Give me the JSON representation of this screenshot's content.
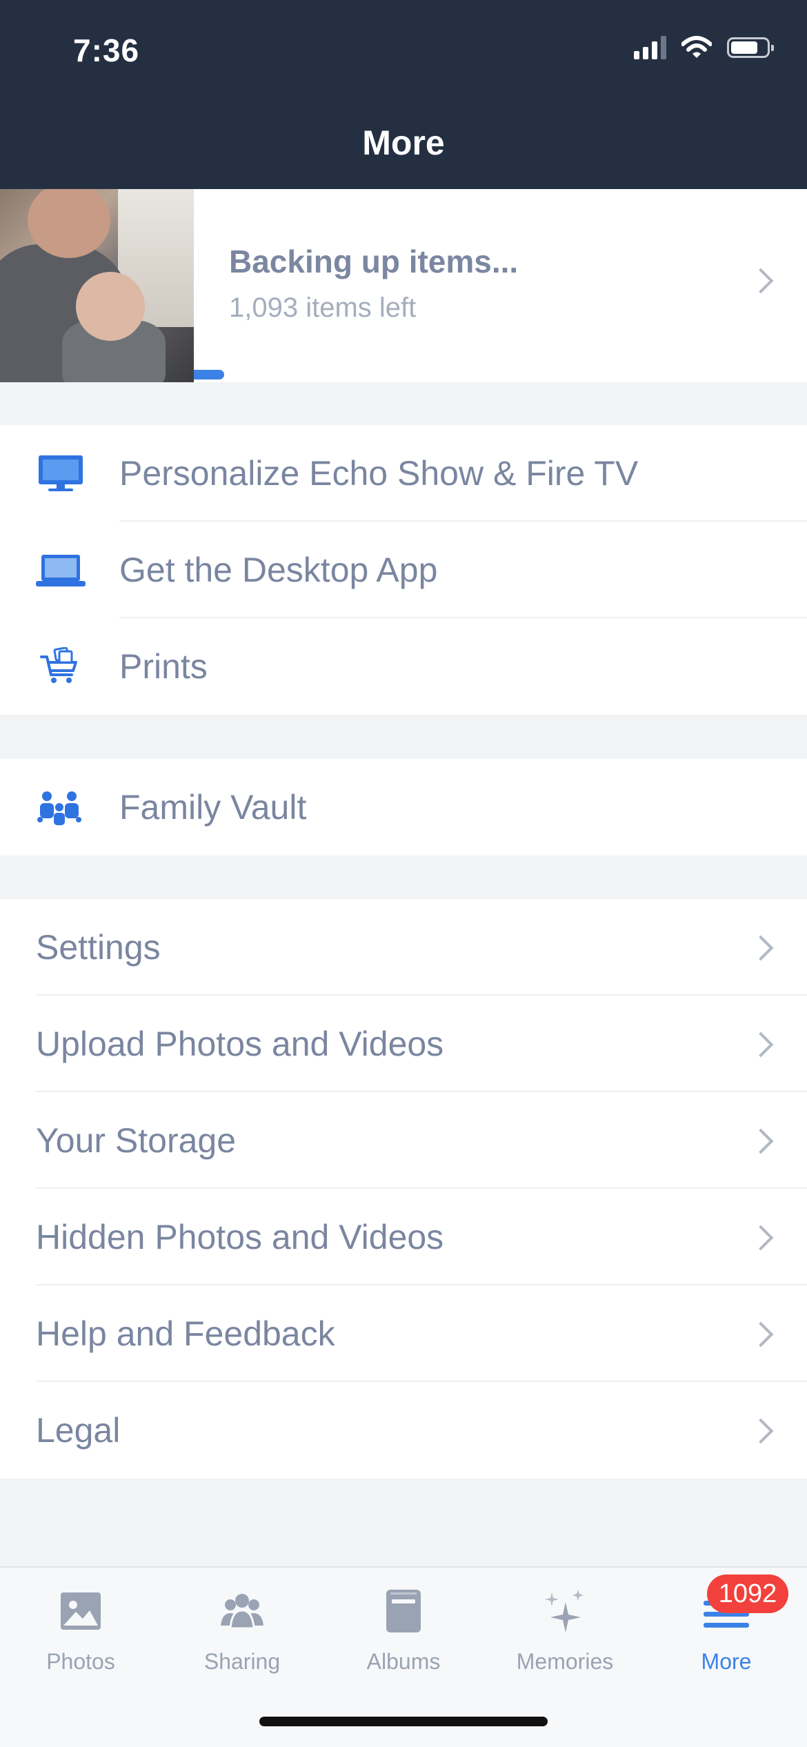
{
  "status_bar": {
    "time": "7:36"
  },
  "header": {
    "title": "More"
  },
  "backup": {
    "title": "Backing up items...",
    "subtitle": "1,093 items left",
    "progress_fraction": 0.05
  },
  "section_devices": {
    "items": [
      {
        "label": "Personalize Echo Show & Fire TV",
        "icon": "monitor-icon"
      },
      {
        "label": "Get the Desktop App",
        "icon": "laptop-icon"
      },
      {
        "label": "Prints",
        "icon": "cart-photo-icon"
      }
    ]
  },
  "section_family": {
    "items": [
      {
        "label": "Family Vault",
        "icon": "family-icon"
      }
    ]
  },
  "section_settings": {
    "items": [
      {
        "label": "Settings"
      },
      {
        "label": "Upload Photos and Videos"
      },
      {
        "label": "Your Storage"
      },
      {
        "label": "Hidden Photos and Videos"
      },
      {
        "label": "Help and Feedback"
      },
      {
        "label": "Legal"
      }
    ]
  },
  "tabbar": {
    "tabs": [
      {
        "label": "Photos",
        "icon": "photo-icon"
      },
      {
        "label": "Sharing",
        "icon": "people-icon"
      },
      {
        "label": "Albums",
        "icon": "album-icon"
      },
      {
        "label": "Memories",
        "icon": "sparkle-icon"
      },
      {
        "label": "More",
        "icon": "menu-icon"
      }
    ],
    "active": "More",
    "more_badge": "1092"
  },
  "colors": {
    "header_bg": "#243042",
    "accent": "#3b82e6",
    "badge": "#f2413c",
    "text": "#7a86a0"
  }
}
